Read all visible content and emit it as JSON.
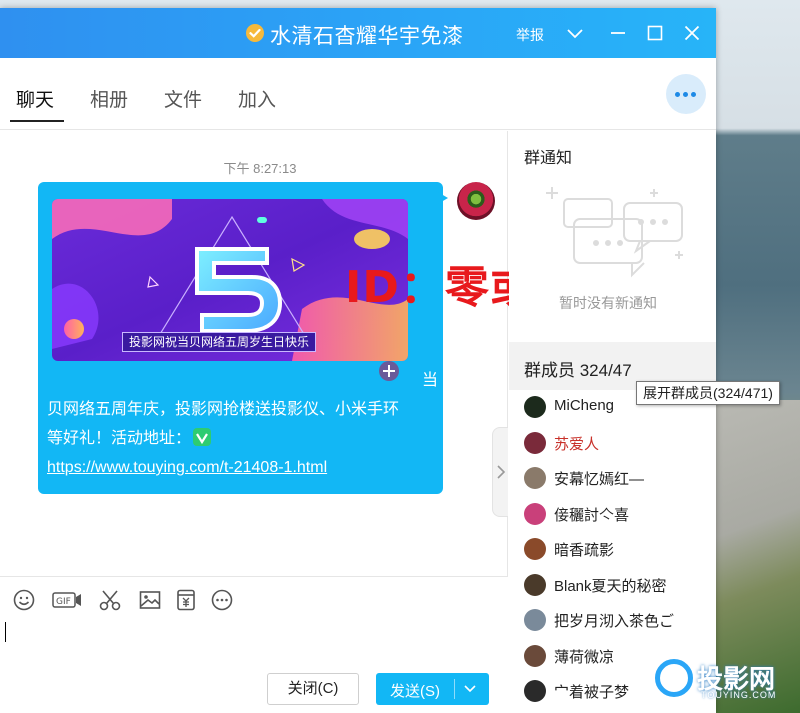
{
  "window": {
    "title": "水清石杳耀华宇免漆",
    "report_label": "举报"
  },
  "tabs": [
    {
      "label": "聊天",
      "active": true
    },
    {
      "label": "相册",
      "active": false
    },
    {
      "label": "文件",
      "active": false
    },
    {
      "label": "加入",
      "active": false
    }
  ],
  "chat": {
    "timestamp": "下午 8:27:13",
    "promo_caption": "投影网祝当贝网络五周岁生日快乐",
    "message_line1": "当",
    "message_line2": "贝网络五周年庆，投影网抢楼送投影仪、小米手环",
    "message_line3": "等好礼！活动地址：",
    "message_link": "https://www.touying.com/t-21408-1.html",
    "overlay_id": "ID：零或零"
  },
  "side": {
    "notice_title": "群通知",
    "notice_empty": "暂时没有新通知",
    "members_title": "群成员 324/47",
    "members_tooltip": "展开群成员(324/471)",
    "members": [
      {
        "name": "MiCheng",
        "red": false,
        "avatar_color": "#1c2a1c"
      },
      {
        "name": "苏爱人",
        "red": true,
        "avatar_color": "#7a2a3a"
      },
      {
        "name": "安幕忆嫣红—",
        "red": false,
        "avatar_color": "#8a7a6a"
      },
      {
        "name": "倿穲討亽喜",
        "red": false,
        "avatar_color": "#c9407a"
      },
      {
        "name": "暗香疏影",
        "red": false,
        "avatar_color": "#8a4a2a"
      },
      {
        "name": "Blank夏天的秘密",
        "red": false,
        "avatar_color": "#4a3a2a"
      },
      {
        "name": "把岁月沏入茶色ご",
        "red": false,
        "avatar_color": "#7a8a9a"
      },
      {
        "name": "薄荷微凉",
        "red": false,
        "avatar_color": "#6a4a3a"
      },
      {
        "name": "宀着被子梦",
        "red": false,
        "avatar_color": "#2a2a2a"
      }
    ]
  },
  "input": {
    "close_label": "关闭(C)",
    "send_label": "发送(S)"
  },
  "watermark": {
    "logo_text": "投影网",
    "logo_sub": "TOUYING.COM"
  }
}
